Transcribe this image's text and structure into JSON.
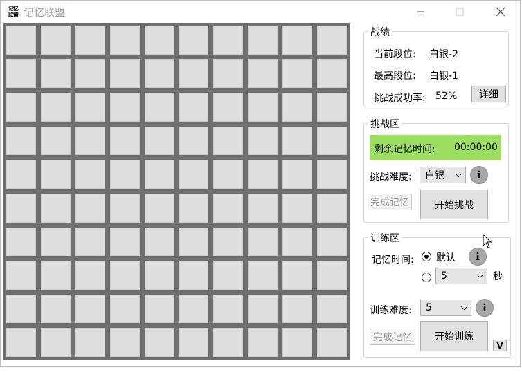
{
  "window": {
    "title": "记忆联盟",
    "icon_text_top": "记忆",
    "icon_text_bottom": "联盟"
  },
  "grid": {
    "rows": 10,
    "cols": 10
  },
  "stats": {
    "title": "战绩",
    "current_rank_label": "当前段位:",
    "current_rank_value": "白银-2",
    "highest_rank_label": "最高段位:",
    "highest_rank_value": "白银-1",
    "success_rate_label": "挑战成功率:",
    "success_rate_value": "52%",
    "details_button": "详细"
  },
  "challenge": {
    "title": "挑战区",
    "remaining_label": "剩余记忆时间:",
    "remaining_value": "00:00:00",
    "timer_color": "#9cdf60",
    "difficulty_label": "挑战难度:",
    "difficulty_value": "白银",
    "info": "i",
    "finish_button": "完成记忆",
    "start_button": "开始挑战"
  },
  "training": {
    "title": "训练区",
    "memory_time_label": "记忆时间:",
    "default_option": "默认",
    "custom_value": "5",
    "seconds_unit": "秒",
    "info": "i",
    "difficulty_label": "训练难度:",
    "difficulty_value": "5",
    "finish_button": "完成记忆",
    "start_button": "开始训练",
    "v_button": "V"
  }
}
